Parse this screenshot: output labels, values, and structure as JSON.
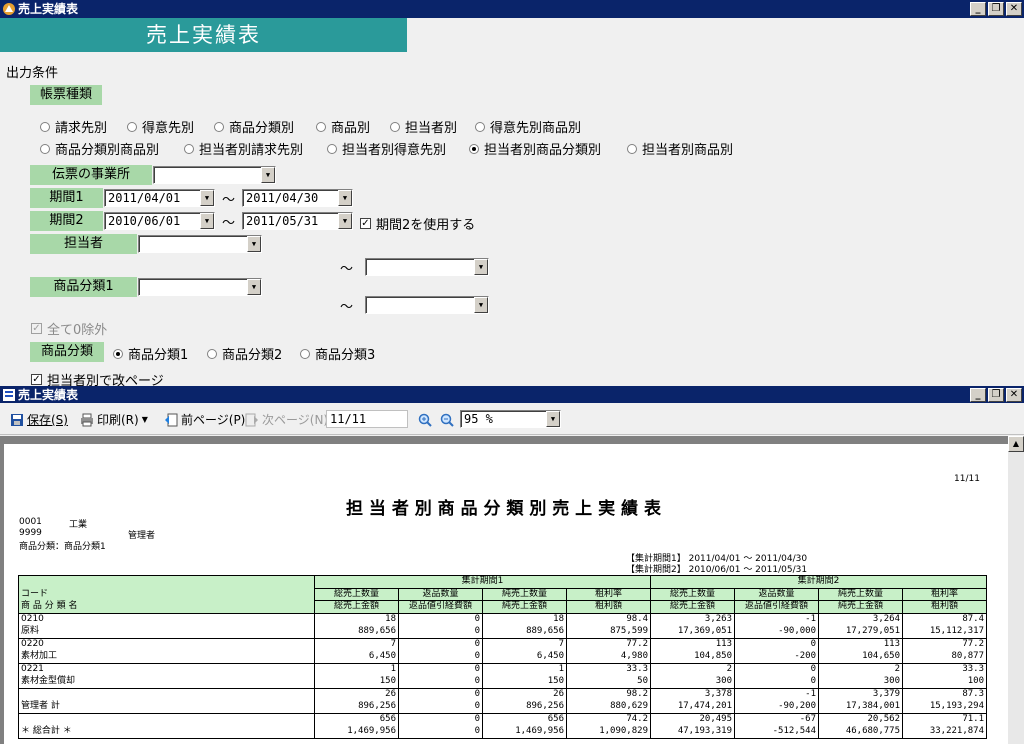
{
  "app": {
    "title": "売上実績表",
    "banner": "売上実績表"
  },
  "form": {
    "output_cond": "出力条件",
    "report_type_label": "帳票種類",
    "report_types_row1": [
      "請求先別",
      "得意先別",
      "商品分類別",
      "商品別",
      "担当者別",
      "得意先別商品別"
    ],
    "report_types_row2": [
      "商品分類別商品別",
      "担当者別請求先別",
      "担当者別得意先別",
      "担当者別商品分類別",
      "担当者別商品別"
    ],
    "selected_type": "担当者別商品分類別",
    "office_label": "伝票の事業所",
    "period1_label": "期間1",
    "period1_from": "2011/04/01",
    "period1_to": "2011/04/30",
    "period2_label": "期間2",
    "period2_from": "2010/06/01",
    "period2_to": "2011/05/31",
    "tilde": "～",
    "use_period2": "期間2を使用する",
    "staff_label": "担当者",
    "category1_label": "商品分類1",
    "exclude_zero": "全て0除外",
    "category_label": "商品分類",
    "category_options": [
      "商品分類1",
      "商品分類2",
      "商品分類3"
    ],
    "page_break": "担当者別で改ページ"
  },
  "viewer": {
    "title": "売上実績表",
    "save": "保存(S)",
    "print": "印刷(R)",
    "prev": "前ページ(P)",
    "next": "次ページ(N)",
    "page": "11/11",
    "zoom": "95 %"
  },
  "report": {
    "page_no": "11/11",
    "title": "担 当 者 別 商 品 分 類 別 売 上 実 績 表",
    "company_code": "0001",
    "company_name": "工業",
    "staff_code": "9999",
    "staff_name": "管理者",
    "category": "商品分類：商品分類1",
    "period1": "【集計期間1】 2011/04/01 ～ 2011/04/30",
    "period2": "【集計期間2】 2010/06/01 ～ 2011/05/31",
    "headers": {
      "code": "コード",
      "name": "商 品 分 類 名",
      "p1": "集計期間1",
      "p2": "集計期間2",
      "sub_top": [
        "総売上数量",
        "返品数量",
        "純売上数量",
        "粗利率"
      ],
      "sub_bottom": [
        "総売上金額",
        "返品値引経費額",
        "純売上金額",
        "粗利額"
      ]
    },
    "rows": [
      {
        "code": "0210",
        "name": "原料",
        "top": [
          "18",
          "0",
          "18",
          "98.4",
          "3,263",
          "-1",
          "3,264",
          "87.4"
        ],
        "bottom": [
          "889,656",
          "0",
          "889,656",
          "875,599",
          "17,369,051",
          "-90,000",
          "17,279,051",
          "15,112,317"
        ]
      },
      {
        "code": "0220",
        "name": "素材加工",
        "top": [
          "7",
          "0",
          "7",
          "77.2",
          "113",
          "0",
          "113",
          "77.2"
        ],
        "bottom": [
          "6,450",
          "0",
          "6,450",
          "4,980",
          "104,850",
          "-200",
          "104,650",
          "80,877"
        ]
      },
      {
        "code": "0221",
        "name": "素材金型償却",
        "top": [
          "1",
          "0",
          "1",
          "33.3",
          "2",
          "0",
          "2",
          "33.3"
        ],
        "bottom": [
          "150",
          "0",
          "150",
          "50",
          "300",
          "0",
          "300",
          "100"
        ]
      },
      {
        "code": "",
        "name": "管理者 計",
        "top": [
          "26",
          "0",
          "26",
          "98.2",
          "3,378",
          "-1",
          "3,379",
          "87.3"
        ],
        "bottom": [
          "896,256",
          "0",
          "896,256",
          "880,629",
          "17,474,201",
          "-90,200",
          "17,384,001",
          "15,193,294"
        ]
      },
      {
        "code": "",
        "name": "＊ 総合計 ＊",
        "top": [
          "656",
          "0",
          "656",
          "74.2",
          "20,495",
          "-67",
          "20,562",
          "71.1"
        ],
        "bottom": [
          "1,469,956",
          "0",
          "1,469,956",
          "1,090,829",
          "47,193,319",
          "-512,544",
          "46,680,775",
          "33,221,874"
        ]
      }
    ]
  }
}
